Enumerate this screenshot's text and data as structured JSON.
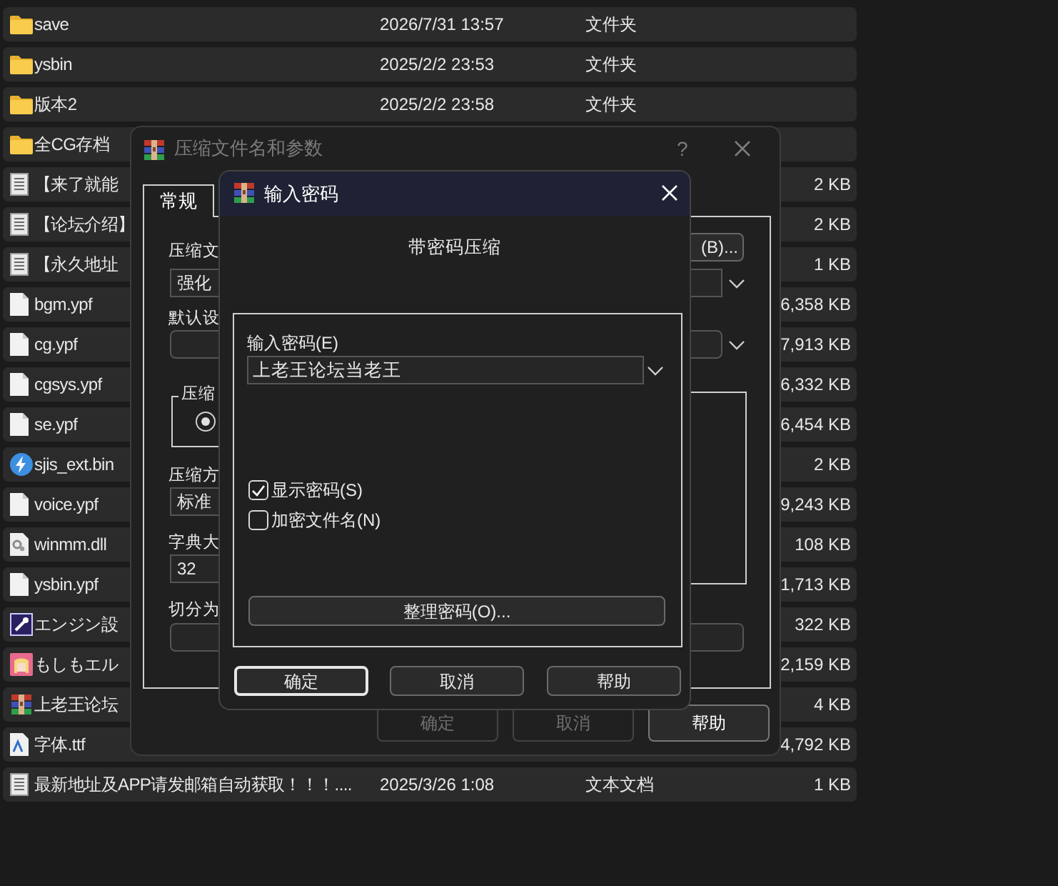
{
  "file_list": {
    "rows": [
      {
        "kind": "folder",
        "name": "save",
        "date": "2026/7/31 13:57",
        "type": "文件夹"
      },
      {
        "kind": "folder",
        "name": "ysbin",
        "date": "2025/2/2 23:53",
        "type": "文件夹"
      },
      {
        "kind": "folder",
        "name": "版本2",
        "date": "2025/2/2 23:58",
        "type": "文件夹"
      },
      {
        "kind": "folder",
        "name": "全CG存档"
      },
      {
        "kind": "document",
        "name": "【来了就能",
        "size": "2 KB"
      },
      {
        "kind": "document",
        "name": "【论坛介绍】",
        "size": "2 KB"
      },
      {
        "kind": "document",
        "name": "【永久地址",
        "size": "1 KB"
      },
      {
        "kind": "file",
        "name": "bgm.ypf",
        "size": "6,358 KB"
      },
      {
        "kind": "file",
        "name": "cg.ypf",
        "size": "7,913 KB"
      },
      {
        "kind": "file",
        "name": "cgsys.ypf",
        "size": "6,332 KB"
      },
      {
        "kind": "file",
        "name": "se.ypf",
        "size": "6,454 KB"
      },
      {
        "kind": "bolt",
        "name": "sjis_ext.bin",
        "size": "2 KB"
      },
      {
        "kind": "file",
        "name": "voice.ypf",
        "size": "9,243 KB"
      },
      {
        "kind": "dll",
        "name": "winmm.dll",
        "size": "108 KB"
      },
      {
        "kind": "file",
        "name": "ysbin.ypf",
        "size": "1,713 KB"
      },
      {
        "kind": "tool",
        "name": "エンジン設",
        "size": "322 KB"
      },
      {
        "kind": "app",
        "name": "もしもエル",
        "size": "2,159 KB"
      },
      {
        "kind": "archive",
        "name": "上老王论坛",
        "size": "4 KB"
      },
      {
        "kind": "font",
        "name": "字体.ttf",
        "size": "4,792 KB"
      },
      {
        "kind": "document",
        "name": "最新地址及APP请发邮箱自动获取！！！....",
        "date": "2025/3/26 1:08",
        "type": "文本文档",
        "size": "1 KB"
      }
    ]
  },
  "archive_dialog": {
    "title": "压缩文件名和参数",
    "help": "?",
    "tabs": [
      {
        "label": "常规",
        "selected": true
      }
    ],
    "archive_name_label": "压缩文",
    "archive_name": "强化",
    "browse_button": "(B)...",
    "profile_label": "默认设",
    "format_group": "压缩",
    "format_options": [
      {
        "selected": true
      }
    ],
    "method_label": "压缩方",
    "method": "标准",
    "dictionary_label": "字典大",
    "dictionary": "32",
    "split_label": "切分为",
    "buttons": [
      {
        "label": "确定",
        "disabled": true
      },
      {
        "label": "取消",
        "disabled": true
      },
      {
        "label": "帮助",
        "disabled": false
      }
    ]
  },
  "password_dialog": {
    "title": "输入密码",
    "heading": "带密码压缩",
    "password_label": "输入密码(E)",
    "password": "上老王论坛当老王",
    "options": [
      {
        "label": "显示密码(S)",
        "checked": true
      },
      {
        "label": "加密文件名(N)",
        "checked": false
      }
    ],
    "organize_button": "整理密码(O)...",
    "buttons": [
      {
        "label": "确定",
        "focused": true
      },
      {
        "label": "取消",
        "focused": false
      },
      {
        "label": "帮助",
        "focused": false
      }
    ]
  }
}
